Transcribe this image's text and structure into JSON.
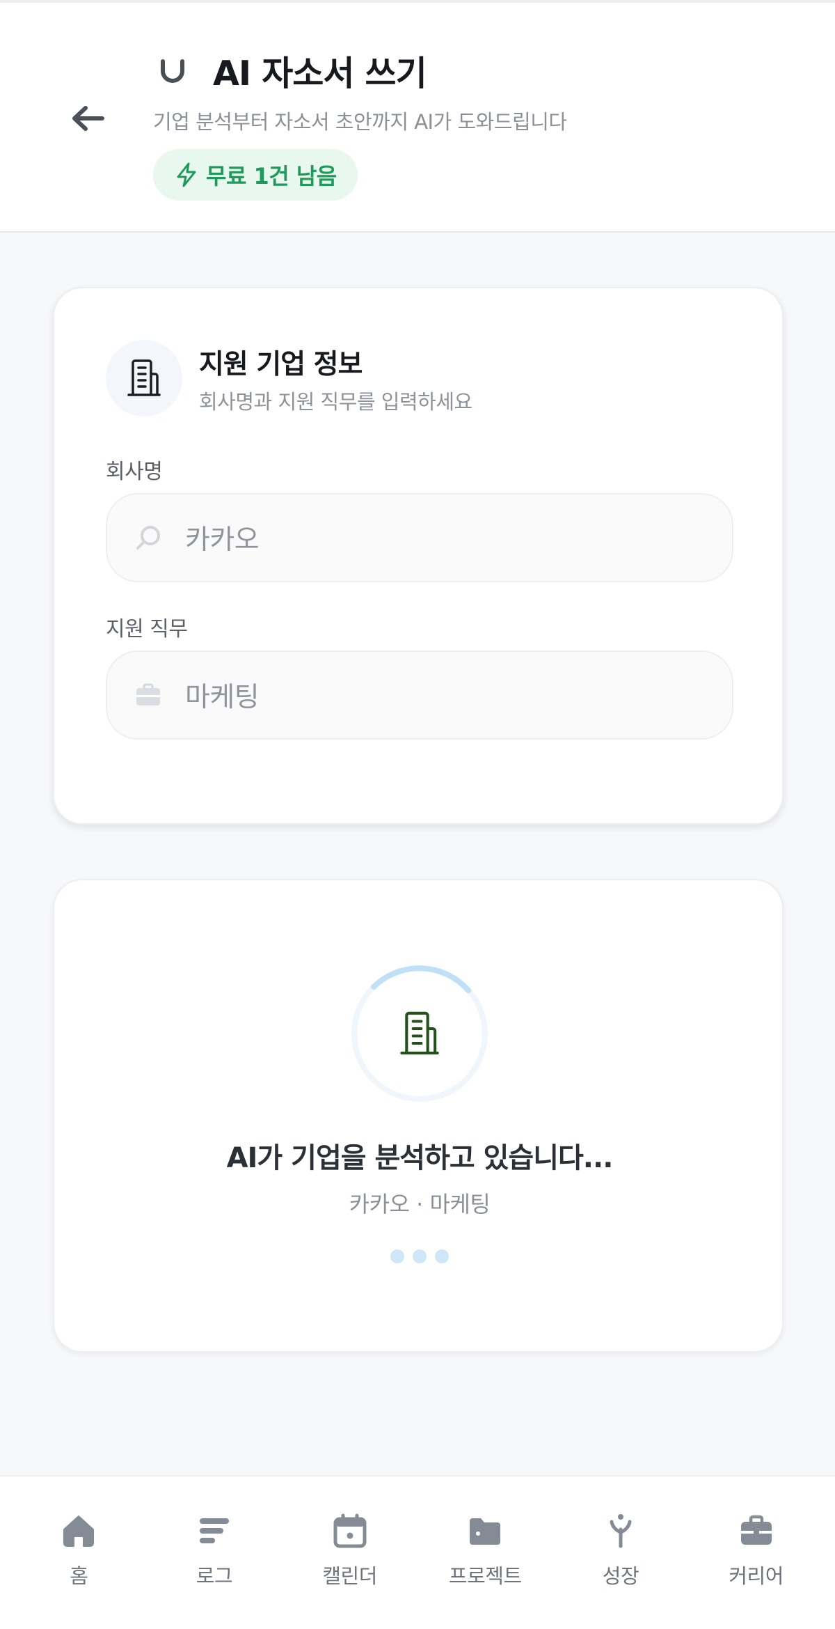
{
  "header": {
    "title": "AI 자소서 쓰기",
    "subtitle": "기업 분석부터 자소서 초안까지 AI가 도와드립니다",
    "badge": "무료 1건 남음",
    "logo_icon": "magnet-icon",
    "back_icon": "arrow-left-icon"
  },
  "company_card": {
    "title": "지원 기업 정보",
    "subtitle": "회사명과 지원 직무를 입력하세요",
    "company_label": "회사명",
    "company_value": "카카오",
    "job_label": "지원 직무",
    "job_value": "마케팅"
  },
  "status_card": {
    "title": "AI가 기업을 분석하고 있습니다...",
    "subtitle": "카카오 · 마케팅"
  },
  "bottom_nav": {
    "items": [
      {
        "label": "홈",
        "icon": "home-icon"
      },
      {
        "label": "로그",
        "icon": "log-icon"
      },
      {
        "label": "캘린더",
        "icon": "calendar-icon"
      },
      {
        "label": "프로젝트",
        "icon": "folder-icon"
      },
      {
        "label": "성장",
        "icon": "sprout-icon"
      },
      {
        "label": "커리어",
        "icon": "briefcase-icon"
      }
    ]
  },
  "colors": {
    "accent_green": "#1f9a5b",
    "badge_bg": "#e8f8ef",
    "spinner_blue": "#bfe0f7",
    "building_green": "#24501a",
    "nav_gray": "#858b95"
  }
}
